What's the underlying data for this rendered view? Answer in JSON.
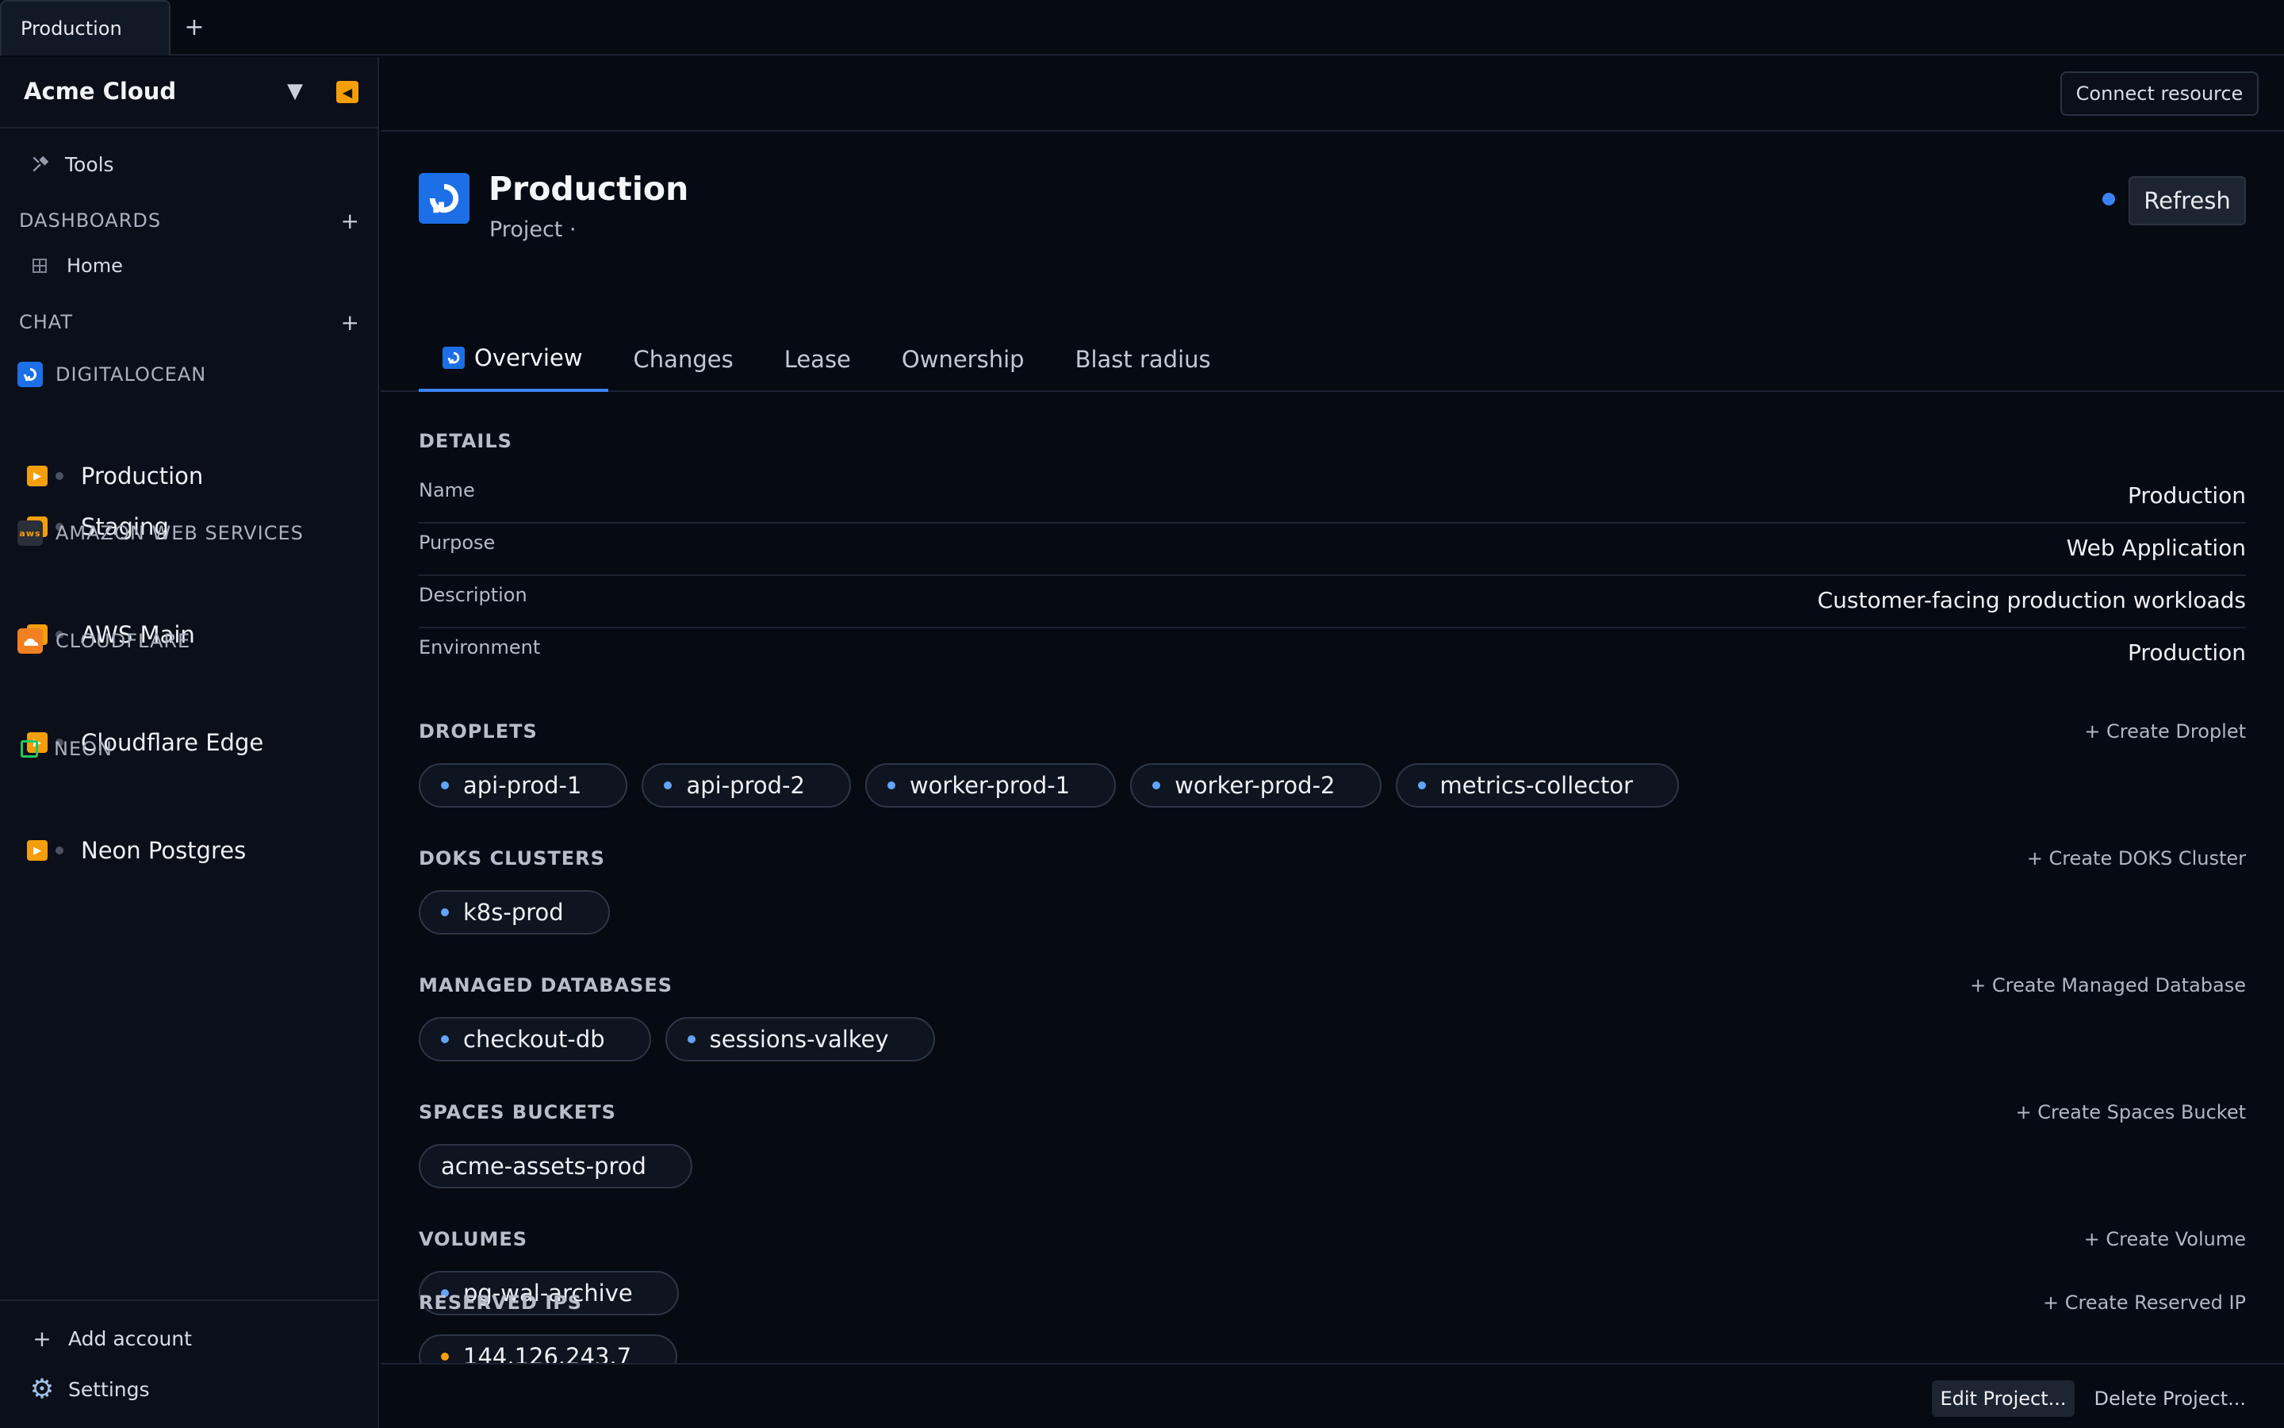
{
  "window_tabs": {
    "active": "Production",
    "new_tab": "+"
  },
  "sidebar": {
    "brand": "Acme Cloud",
    "dropdown": "▼",
    "collapse": "◀",
    "tools": "Tools",
    "dashboards_title": "DASHBOARDS",
    "home": "Home",
    "chat_title": "CHAT",
    "plus": "+",
    "providers": [
      {
        "name": "DIGITALOCEAN",
        "accounts": [
          "Production",
          "Staging"
        ]
      },
      {
        "name": "AMAZON WEB SERVICES",
        "logo_text": "aws",
        "accounts": [
          "AWS Main"
        ]
      },
      {
        "name": "CLOUDFLARE",
        "accounts": [
          "Cloudflare Edge"
        ]
      },
      {
        "name": "NEON",
        "accounts": [
          "Neon Postgres"
        ]
      }
    ],
    "add_account": "Add account",
    "settings": "Settings"
  },
  "header": {
    "connect_resource": "Connect resource",
    "title": "Production",
    "subtitle": "Project ·",
    "refresh": "Refresh"
  },
  "tabs": [
    "Overview",
    "Changes",
    "Lease",
    "Ownership",
    "Blast radius"
  ],
  "details": {
    "title": "DETAILS",
    "rows": [
      {
        "key": "Name",
        "value": "Production"
      },
      {
        "key": "Purpose",
        "value": "Web Application"
      },
      {
        "key": "Description",
        "value": "Customer-facing production workloads"
      },
      {
        "key": "Environment",
        "value": "Production"
      }
    ]
  },
  "sections": {
    "droplets": {
      "title": "DROPLETS",
      "create": "+ Create Droplet",
      "items": [
        "api-prod-1",
        "api-prod-2",
        "worker-prod-1",
        "worker-prod-2",
        "metrics-collector"
      ]
    },
    "doks": {
      "title": "DOKS CLUSTERS",
      "create": "+ Create DOKS Cluster",
      "items": [
        "k8s-prod"
      ]
    },
    "databases": {
      "title": "MANAGED DATABASES",
      "create": "+ Create Managed Database",
      "items": [
        "checkout-db",
        "sessions-valkey"
      ]
    },
    "spaces": {
      "title": "SPACES BUCKETS",
      "create": "+ Create Spaces Bucket",
      "items": [
        "acme-assets-prod"
      ]
    },
    "volumes": {
      "title": "VOLUMES",
      "create": "+ Create Volume",
      "items": [
        "pg-wal-archive"
      ]
    },
    "reserved_ips": {
      "title": "RESERVED IPS",
      "create": "+ Create Reserved IP",
      "items": [
        "144.126.243.7"
      ]
    }
  },
  "footer": {
    "edit": "Edit Project...",
    "delete": "Delete Project..."
  },
  "colors": {
    "accent": "#3b82f6",
    "brand_do": "#1d6fe8",
    "play": "#f59e0b",
    "background": "#060a12"
  }
}
